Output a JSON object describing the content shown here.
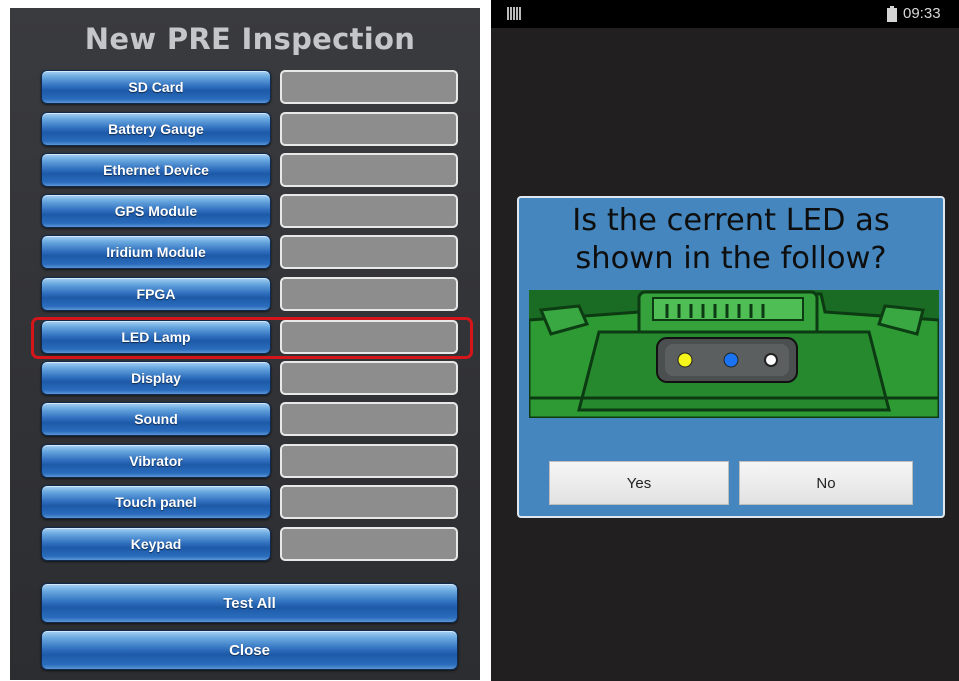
{
  "inspection_screen": {
    "title": "New PRE Inspection",
    "items": [
      {
        "label": "SD Card",
        "result": ""
      },
      {
        "label": "Battery Gauge",
        "result": ""
      },
      {
        "label": "Ethernet Device",
        "result": ""
      },
      {
        "label": "GPS Module",
        "result": ""
      },
      {
        "label": "Iridium Module",
        "result": ""
      },
      {
        "label": "FPGA",
        "result": ""
      },
      {
        "label": "LED Lamp",
        "result": ""
      },
      {
        "label": "Display",
        "result": ""
      },
      {
        "label": "Sound",
        "result": ""
      },
      {
        "label": "Vibrator",
        "result": ""
      },
      {
        "label": "Touch panel",
        "result": ""
      },
      {
        "label": "Keypad",
        "result": ""
      }
    ],
    "highlighted_item": "LED Lamp",
    "test_all_label": "Test All",
    "close_label": "Close",
    "colors": {
      "button_blue": "#2f6fbd",
      "result_gray": "#8d8d8e",
      "highlight_red": "#d4161a"
    }
  },
  "status_bar": {
    "time": "09:33",
    "icons": [
      "signal-icon",
      "battery-icon"
    ]
  },
  "led_dialog": {
    "question": "Is the cerrent LED as shown in the follow?",
    "image": "device-led-photo",
    "led_colors": [
      "yellow",
      "blue",
      "white"
    ],
    "yes_label": "Yes",
    "no_label": "No",
    "colors": {
      "dialog_bg": "#4486bd",
      "device_green": "#2e9a34"
    }
  }
}
